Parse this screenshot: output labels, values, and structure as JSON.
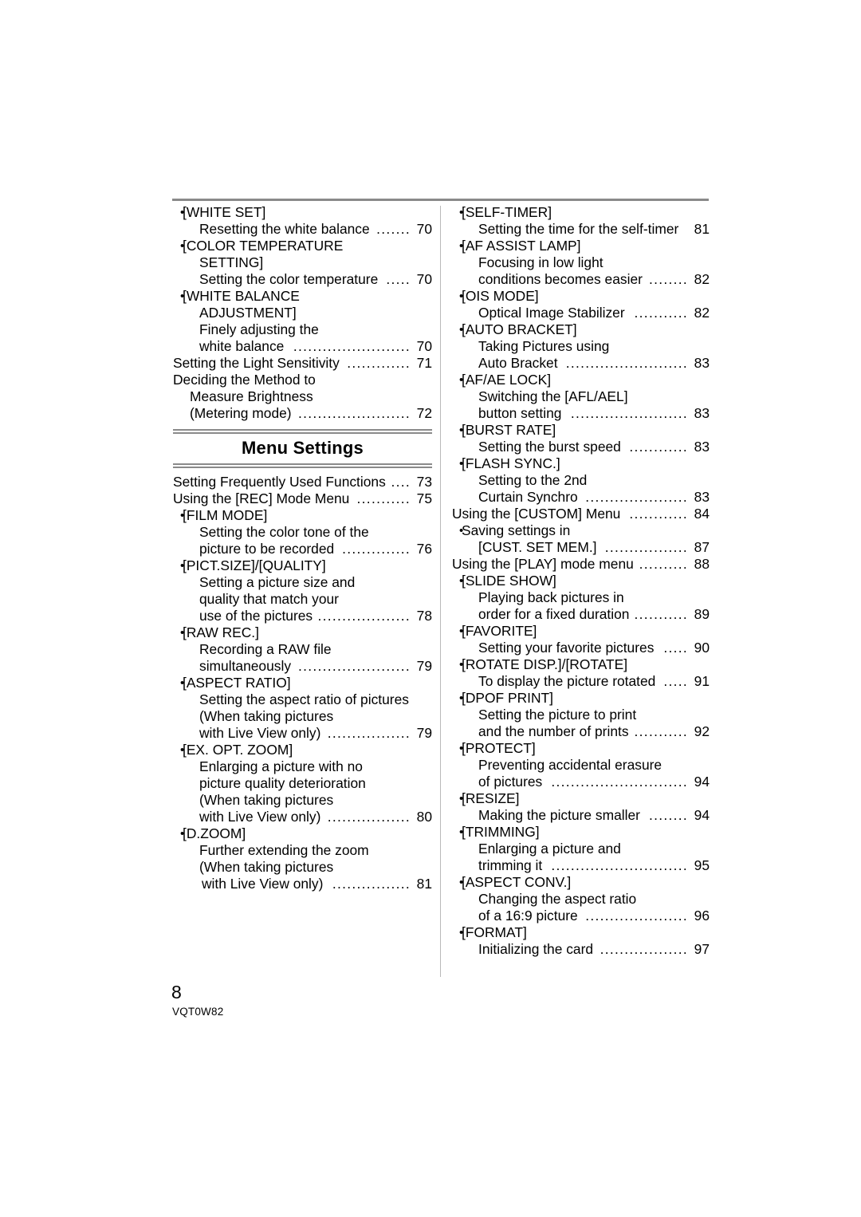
{
  "document": {
    "page_number": "8",
    "doc_code": "VQT0W82"
  },
  "left_column": {
    "rows_before_section": [
      {
        "level": "bullet",
        "text": "[WHITE SET]",
        "page": ""
      },
      {
        "level": "under",
        "text": "Resetting the white balance",
        "page": "70"
      },
      {
        "level": "bullet",
        "text": "[COLOR TEMPERATURE",
        "page": ""
      },
      {
        "level": "under",
        "text": "SETTING]",
        "page": ""
      },
      {
        "level": "under",
        "text": "Setting the color temperature",
        "page": "70"
      },
      {
        "level": "bullet",
        "text": "[WHITE BALANCE",
        "page": ""
      },
      {
        "level": "under",
        "text": "ADJUSTMENT]",
        "page": ""
      },
      {
        "level": "under",
        "text": "Finely adjusting the",
        "page": ""
      },
      {
        "level": "under",
        "text": "white balance",
        "page": "70"
      },
      {
        "level": "top",
        "text": "Setting the Light Sensitivity",
        "page": "71"
      },
      {
        "level": "top",
        "text": "Deciding the Method to",
        "page": ""
      },
      {
        "level": "cont",
        "text": "Measure Brightness",
        "page": ""
      },
      {
        "level": "cont",
        "text": "(Metering mode)",
        "page": "72"
      }
    ],
    "section_title": "Menu Settings",
    "rows_after_section": [
      {
        "level": "top",
        "text": "Setting Frequently Used Functions",
        "page": "73"
      },
      {
        "level": "top",
        "text": "Using the [REC] Mode Menu",
        "page": "75"
      },
      {
        "level": "bullet",
        "text": "[FILM MODE]",
        "page": ""
      },
      {
        "level": "under",
        "text": "Setting the color tone of the",
        "page": ""
      },
      {
        "level": "under",
        "text": "picture to be recorded",
        "page": "76"
      },
      {
        "level": "bullet",
        "text": "[PICT.SIZE]/[QUALITY]",
        "page": ""
      },
      {
        "level": "under",
        "text": "Setting a picture size and",
        "page": ""
      },
      {
        "level": "under",
        "text": "quality that match your",
        "page": ""
      },
      {
        "level": "under",
        "text": "use of the pictures",
        "page": "78"
      },
      {
        "level": "bullet",
        "text": "[RAW REC.]",
        "page": ""
      },
      {
        "level": "under",
        "text": "Recording a RAW file",
        "page": ""
      },
      {
        "level": "under",
        "text": "simultaneously",
        "page": "79"
      },
      {
        "level": "bullet",
        "text": "[ASPECT RATIO]",
        "page": ""
      },
      {
        "level": "under",
        "text": "Setting the aspect ratio of pictures",
        "page": ""
      },
      {
        "level": "under",
        "text": "(When taking pictures",
        "page": ""
      },
      {
        "level": "under",
        "text": "with Live View only)",
        "page": "79"
      },
      {
        "level": "bullet",
        "text": "[EX. OPT. ZOOM]",
        "page": ""
      },
      {
        "level": "under",
        "text": "Enlarging a picture with no",
        "page": ""
      },
      {
        "level": "under",
        "text": "picture quality deterioration",
        "page": ""
      },
      {
        "level": "under",
        "text": "(When taking pictures",
        "page": ""
      },
      {
        "level": "under",
        "text": "with Live View only)",
        "page": "80"
      },
      {
        "level": "bullet",
        "text": "[D.ZOOM]",
        "page": ""
      },
      {
        "level": "under",
        "text": "Further extending the zoom",
        "page": ""
      },
      {
        "level": "under",
        "text": "(When taking pictures",
        "page": ""
      },
      {
        "level": "under2",
        "text": "with Live View only)",
        "page": "81"
      }
    ]
  },
  "right_column": {
    "rows": [
      {
        "level": "bullet",
        "text": "[SELF-TIMER]",
        "page": ""
      },
      {
        "level": "under",
        "text": "Setting the time for the self-timer",
        "page": "81"
      },
      {
        "level": "bullet",
        "text": "[AF ASSIST LAMP]",
        "page": ""
      },
      {
        "level": "under",
        "text": "Focusing in low light",
        "page": ""
      },
      {
        "level": "under",
        "text": "conditions becomes easier",
        "page": "82"
      },
      {
        "level": "bullet",
        "text": "[OIS MODE]",
        "page": ""
      },
      {
        "level": "under",
        "text": "Optical Image Stabilizer",
        "page": "82"
      },
      {
        "level": "bullet",
        "text": "[AUTO BRACKET]",
        "page": ""
      },
      {
        "level": "under",
        "text": "Taking Pictures using",
        "page": ""
      },
      {
        "level": "under",
        "text": "Auto Bracket",
        "page": "83"
      },
      {
        "level": "bullet",
        "text": "[AF/AE LOCK]",
        "page": ""
      },
      {
        "level": "under",
        "text": "Switching the [AFL/AEL]",
        "page": ""
      },
      {
        "level": "under",
        "text": "button setting",
        "page": "83"
      },
      {
        "level": "bullet",
        "text": "[BURST RATE]",
        "page": ""
      },
      {
        "level": "under",
        "text": "Setting the burst speed",
        "page": "83"
      },
      {
        "level": "bullet",
        "text": "[FLASH SYNC.]",
        "page": ""
      },
      {
        "level": "under",
        "text": "Setting to the 2nd",
        "page": ""
      },
      {
        "level": "under",
        "text": "Curtain Synchro",
        "page": "83"
      },
      {
        "level": "top",
        "text": "Using the [CUSTOM] Menu",
        "page": "84"
      },
      {
        "level": "bullet",
        "text": "Saving settings in",
        "page": ""
      },
      {
        "level": "under",
        "text": "[CUST. SET MEM.]",
        "page": "87"
      },
      {
        "level": "top",
        "text": "Using the [PLAY] mode menu",
        "page": "88"
      },
      {
        "level": "bullet",
        "text": "[SLIDE SHOW]",
        "page": ""
      },
      {
        "level": "under",
        "text": "Playing back pictures in",
        "page": ""
      },
      {
        "level": "under",
        "text": "order for a fixed duration",
        "page": "89"
      },
      {
        "level": "bullet",
        "text": "[FAVORITE]",
        "page": ""
      },
      {
        "level": "under",
        "text": "Setting your favorite pictures",
        "page": "90"
      },
      {
        "level": "bullet",
        "text": "[ROTATE DISP.]/[ROTATE]",
        "page": ""
      },
      {
        "level": "under",
        "text": "To display the picture rotated",
        "page": "91"
      },
      {
        "level": "bullet",
        "text": "[DPOF PRINT]",
        "page": ""
      },
      {
        "level": "under",
        "text": "Setting the picture to print",
        "page": ""
      },
      {
        "level": "under",
        "text": "and the number of prints",
        "page": "92"
      },
      {
        "level": "bullet",
        "text": "[PROTECT]",
        "page": ""
      },
      {
        "level": "under",
        "text": "Preventing accidental erasure",
        "page": ""
      },
      {
        "level": "under",
        "text": "of pictures",
        "page": "94"
      },
      {
        "level": "bullet",
        "text": "[RESIZE]",
        "page": ""
      },
      {
        "level": "under",
        "text": "Making the picture smaller",
        "page": "94"
      },
      {
        "level": "bullet",
        "text": "[TRIMMING]",
        "page": ""
      },
      {
        "level": "under",
        "text": "Enlarging a picture and",
        "page": ""
      },
      {
        "level": "under",
        "text": "trimming it",
        "page": "95"
      },
      {
        "level": "bullet",
        "text": "[ASPECT CONV.]",
        "page": ""
      },
      {
        "level": "under",
        "text": "Changing the aspect ratio",
        "page": ""
      },
      {
        "level": "under",
        "text": "of a 16:9 picture",
        "page": "96"
      },
      {
        "level": "bullet",
        "text": "[FORMAT]",
        "page": ""
      },
      {
        "level": "under",
        "text": "Initializing the card",
        "page": "97"
      }
    ]
  }
}
